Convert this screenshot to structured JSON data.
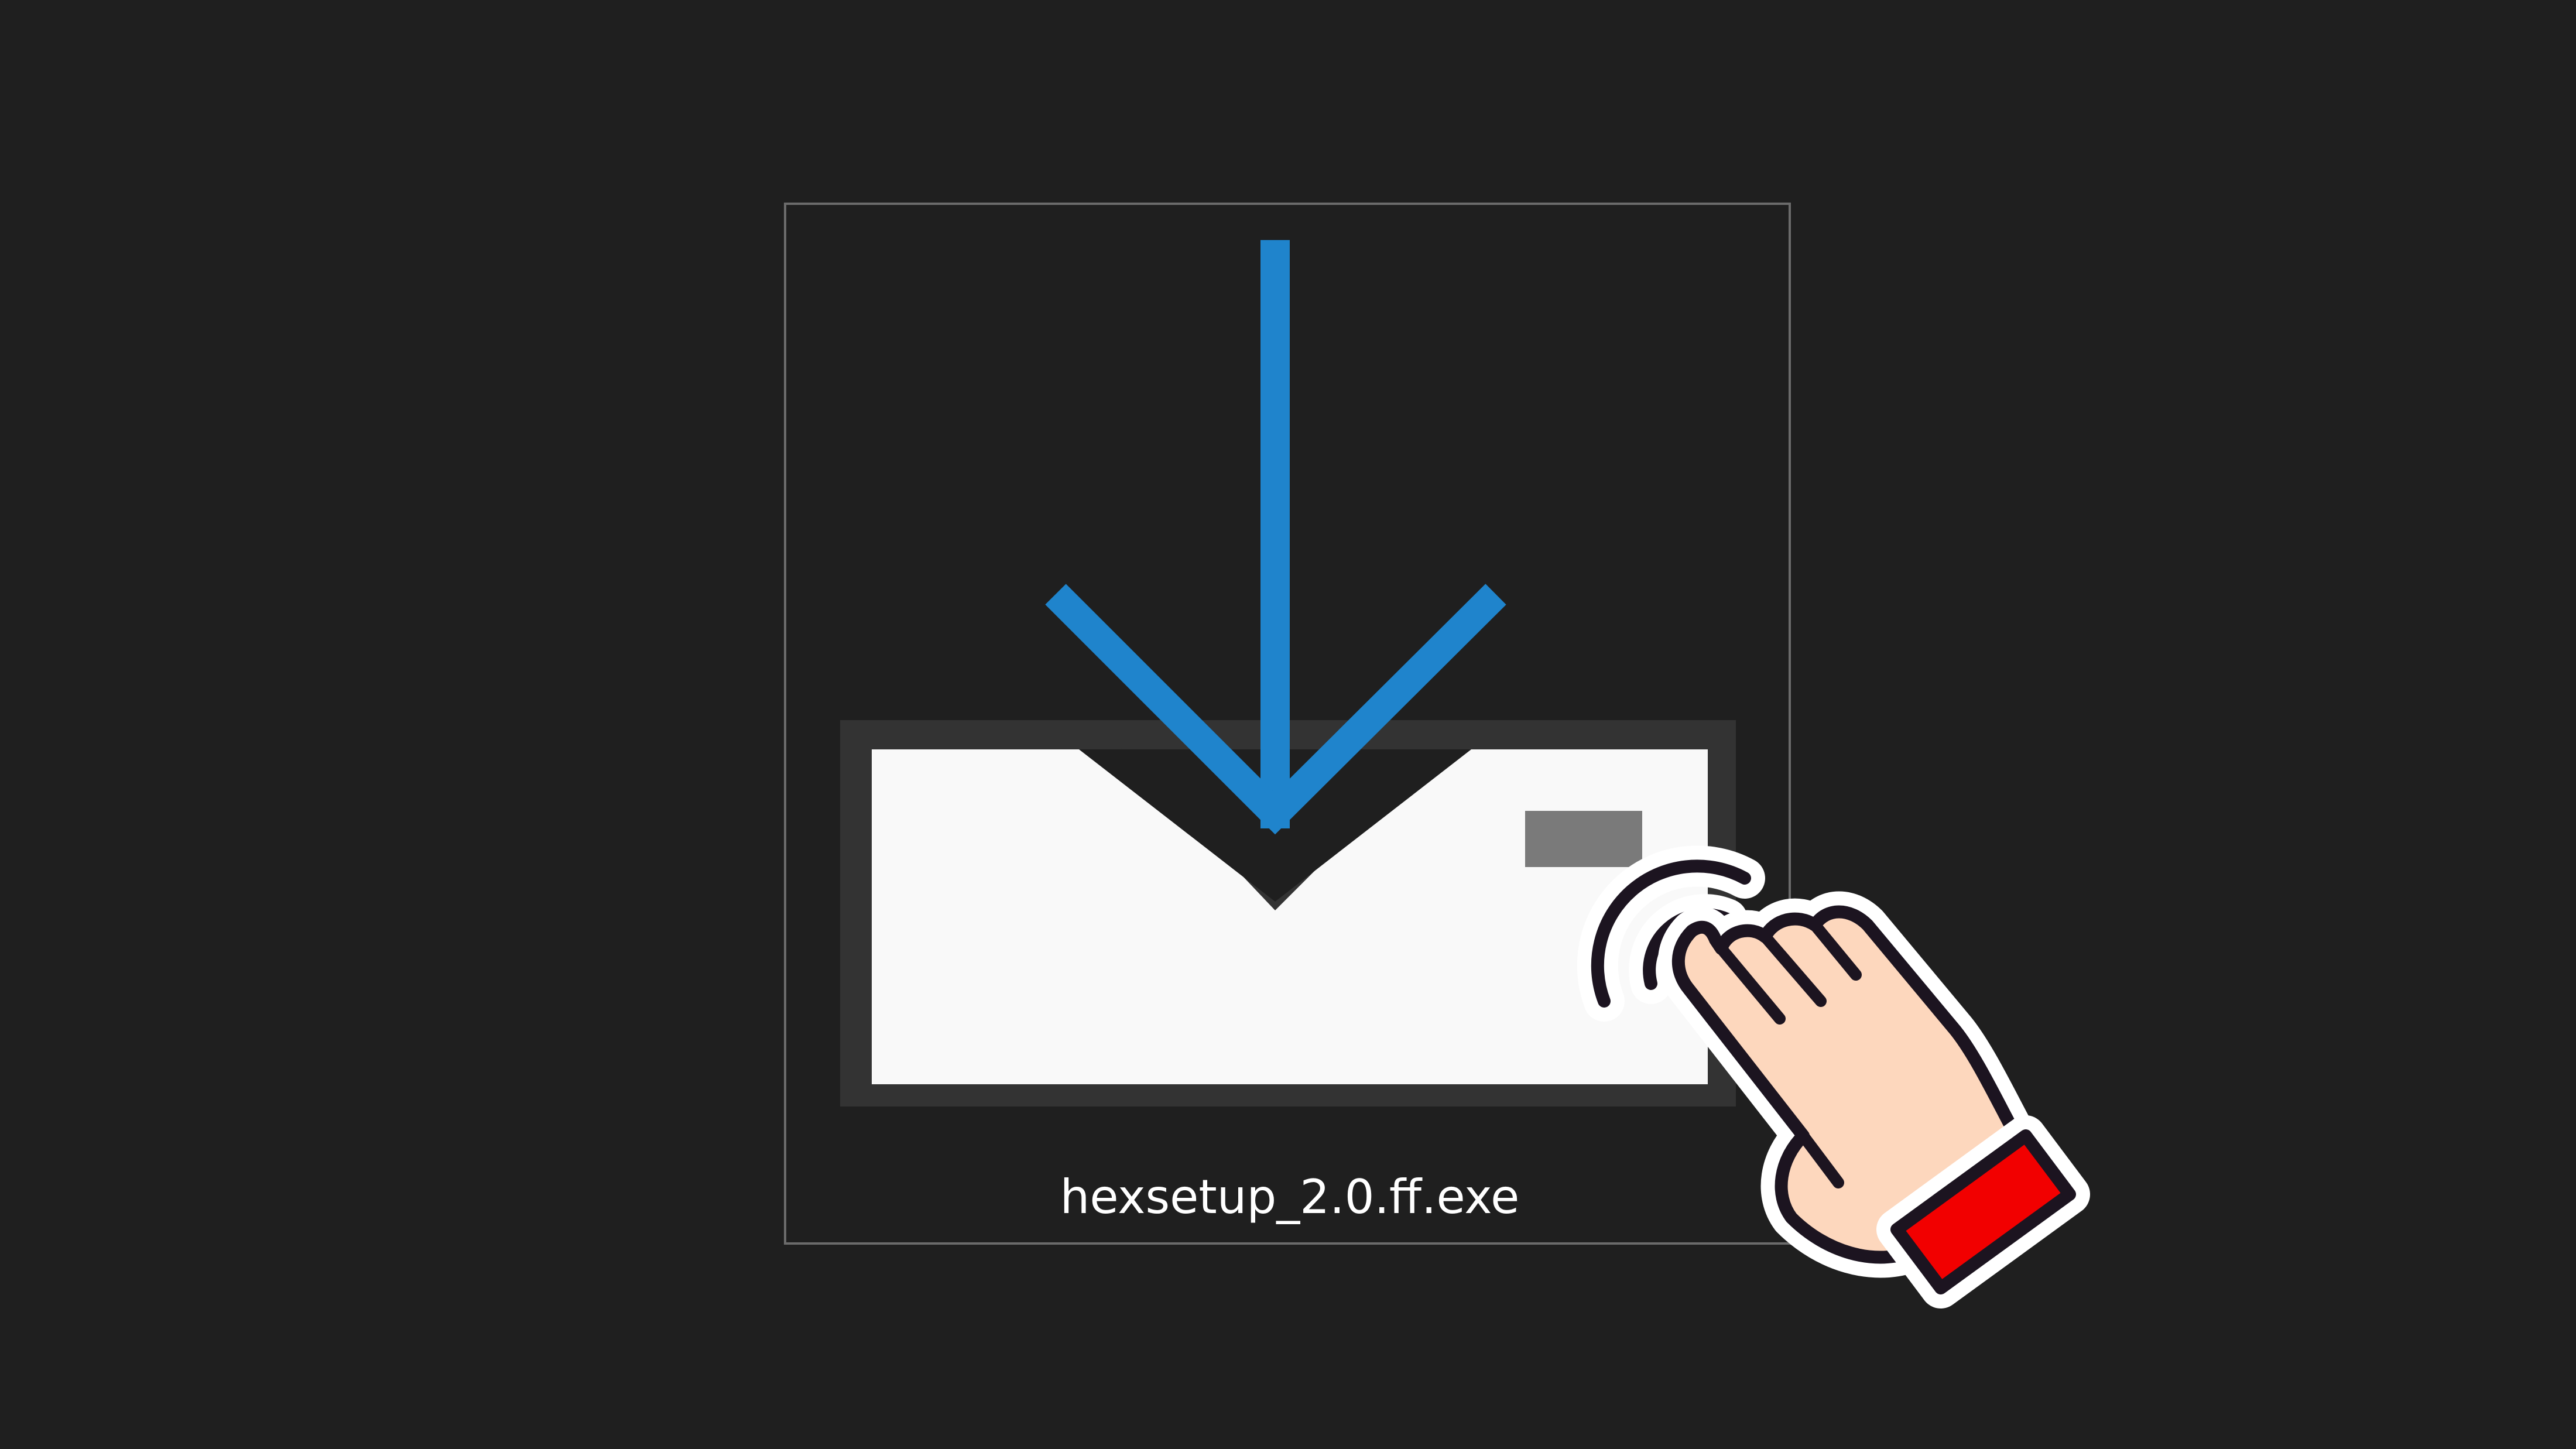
{
  "file": {
    "name": "hexsetup_2.0.ff.exe",
    "icon": "download-installer-icon"
  },
  "cursor": {
    "icon": "hand-pointer-click-icon"
  },
  "colors": {
    "background": "#1f1f1f",
    "arrow": "#1f84cc",
    "tray": "#f9f9f9",
    "tray_frame": "#333333",
    "cuff": "#f20000",
    "skin": "#fdd7bd"
  }
}
